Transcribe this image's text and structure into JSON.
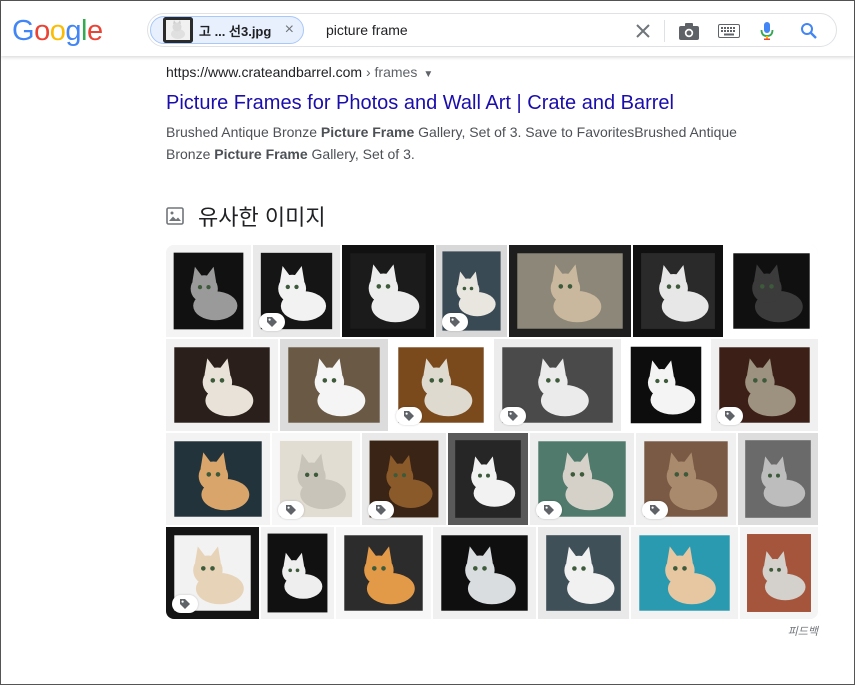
{
  "header": {
    "logo_letters": [
      {
        "ch": "G",
        "color": "#4285F4"
      },
      {
        "ch": "o",
        "color": "#EA4335"
      },
      {
        "ch": "o",
        "color": "#FBBC05"
      },
      {
        "ch": "g",
        "color": "#4285F4"
      },
      {
        "ch": "l",
        "color": "#34A853"
      },
      {
        "ch": "e",
        "color": "#EA4335"
      }
    ],
    "chip_label": "고 ... 선3.jpg",
    "chip_close": "×",
    "query": "picture frame",
    "icons": [
      "clear-icon",
      "camera-icon",
      "keyboard-icon",
      "microphone-icon",
      "search-icon"
    ]
  },
  "result": {
    "url": "https://www.crateandbarrel.com",
    "crumb": " › frames",
    "title": "Picture Frames for Photos and Wall Art | Crate and Barrel",
    "snippet_parts": [
      {
        "text": "Brushed Antique Bronze ",
        "bold": false
      },
      {
        "text": "Picture Frame",
        "bold": true
      },
      {
        "text": " Gallery, Set of 3. Save to FavoritesBrushed Antique Bronze ",
        "bold": false
      },
      {
        "text": "Picture Frame",
        "bold": true
      },
      {
        "text": " Gallery, Set of 3.",
        "bold": false
      }
    ]
  },
  "similar": {
    "title": "유사한 이미지",
    "feedback": "피드백",
    "rows": [
      [
        {
          "bg": "#111111",
          "frame": "#f4f4f4",
          "cat": "#9a9a9a",
          "tag": false
        },
        {
          "bg": "#151515",
          "frame": "#e9e9e9",
          "cat": "#f2f2f2",
          "tag": true
        },
        {
          "bg": "#1b1b1b",
          "frame": "#111111",
          "cat": "#ededed",
          "tag": false
        },
        {
          "bg": "#3a4a55",
          "frame": "#d8d8d8",
          "cat": "#e9e6df",
          "tag": true
        },
        {
          "bg": "#8c8778",
          "frame": "#1e1e1e",
          "cat": "#c9b89e",
          "tag": false
        },
        {
          "bg": "#2a2a2a",
          "frame": "#101010",
          "cat": "#e7e7e7",
          "tag": false
        },
        {
          "bg": "#101010",
          "frame": "#ffffff",
          "cat": "#3b3b3b",
          "tag": false
        }
      ],
      [
        {
          "bg": "#2a1f1a",
          "frame": "#f2f2f2",
          "cat": "#e8e2d8",
          "tag": false
        },
        {
          "bg": "#6a5a45",
          "frame": "#dcdcdc",
          "cat": "#f5f5f5",
          "tag": false
        },
        {
          "bg": "#7a4a1d",
          "frame": "#ffffff",
          "cat": "#dedad0",
          "tag": true
        },
        {
          "bg": "#4a4a4a",
          "frame": "#ececec",
          "cat": "#ebebeb",
          "tag": true
        },
        {
          "bg": "#0d0d0d",
          "frame": "#ffffff",
          "cat": "#f4f4f4",
          "tag": false
        },
        {
          "bg": "#3c2018",
          "frame": "#f0f0f0",
          "cat": "#9d9180",
          "tag": true
        }
      ],
      [
        {
          "bg": "#23333b",
          "frame": "#f3f3f3",
          "cat": "#d9a56a",
          "tag": false
        },
        {
          "bg": "#e2ddd3",
          "frame": "#f7f7f7",
          "cat": "#c9c4ba",
          "tag": true
        },
        {
          "bg": "#3a2416",
          "frame": "#e9e9e9",
          "cat": "#8a5a2a",
          "tag": true
        },
        {
          "bg": "#262626",
          "frame": "#5a5a5a",
          "cat": "#f2f2f2",
          "tag": false
        },
        {
          "bg": "#4f7a6c",
          "frame": "#eeeeee",
          "cat": "#d6d1c8",
          "tag": true
        },
        {
          "bg": "#7a5a44",
          "frame": "#f0f0f0",
          "cat": "#a98a6c",
          "tag": true
        },
        {
          "bg": "#6a6a6a",
          "frame": "#dddddd",
          "cat": "#bdbdbd",
          "tag": false
        }
      ],
      [
        {
          "bg": "#f2f2f2",
          "frame": "#141414",
          "cat": "#e7d3b8",
          "tag": true
        },
        {
          "bg": "#111111",
          "frame": "#f2f2f2",
          "cat": "#eeeeee",
          "tag": false
        },
        {
          "bg": "#2c2c2c",
          "frame": "#f7f7f7",
          "cat": "#e39a48",
          "tag": false
        },
        {
          "bg": "#0f0f0f",
          "frame": "#f0f0f0",
          "cat": "#d9dde0",
          "tag": false
        },
        {
          "bg": "#405058",
          "frame": "#e9e9e9",
          "cat": "#f1f1f1",
          "tag": false
        },
        {
          "bg": "#2a9ab0",
          "frame": "#f2f2f2",
          "cat": "#e7c6a2",
          "tag": false
        },
        {
          "bg": "#a5553c",
          "frame": "#f4f4f4",
          "cat": "#d4d0cb",
          "tag": false
        }
      ]
    ]
  }
}
